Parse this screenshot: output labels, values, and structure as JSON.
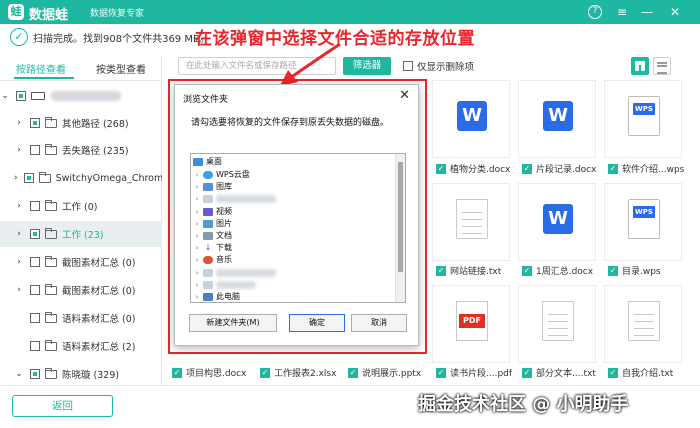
{
  "app": {
    "logo_char": "蛙",
    "name": "数据蛙",
    "subtitle": "数据恢复专家",
    "help_glyph": "?",
    "menu_glyph": "≡",
    "min_glyph": "—",
    "close_glyph": "✕"
  },
  "status": {
    "check_glyph": "✓",
    "text": "扫描完成。找到908个文件共369 MB。"
  },
  "headline": "在该弹窗中选择文件合适的存放位置",
  "left_panel": {
    "tabs": [
      "按路径查看",
      "按类型查看"
    ],
    "items": [
      {
        "label": "其他路径 (268)"
      },
      {
        "label": "丢失路径 (235)"
      },
      {
        "label": "SwitchyOmega_Chromium"
      },
      {
        "label": "工作 (0)"
      },
      {
        "label": "工作 (23)"
      },
      {
        "label": "截图素材汇总 (0)"
      },
      {
        "label": "截图素材汇总 (0)"
      },
      {
        "label": "语料素材汇总 (0)"
      },
      {
        "label": "语料素材汇总 (2)"
      },
      {
        "label": "陈晓璇 (329)"
      }
    ]
  },
  "toolbar": {
    "search_placeholder": "在此处输入文件名或保存路径",
    "filter_label": "筛选器",
    "show_deleted_label": "仅显示删除项"
  },
  "files": [
    {
      "name": "植物分类.docx",
      "type": "word"
    },
    {
      "name": "片段记录.docx",
      "type": "word"
    },
    {
      "name": "软件介绍...wps",
      "type": "wps"
    },
    {
      "name": "网站链接.txt",
      "type": "txt"
    },
    {
      "name": "1周汇总.docx",
      "type": "word"
    },
    {
      "name": "目录.wps",
      "type": "wps"
    },
    {
      "name": "读书片段....pdf",
      "type": "pdf"
    },
    {
      "name": "部分文本....txt",
      "type": "txt"
    },
    {
      "name": "自我介绍.txt",
      "type": "txt"
    }
  ],
  "bottom_files": [
    "项目构思.docx",
    "工作报表2.xlsx",
    "说明展示.pptx"
  ],
  "dialog": {
    "title": "浏览文件夹",
    "close_glyph": "✕",
    "message": "请勾选要将恢复的文件保存到原丢失数据的磁盘。",
    "tree": {
      "root": "桌面",
      "items": [
        "WPS云盘",
        "图库",
        "视频",
        "图片",
        "文档",
        "下载",
        "音乐",
        "此电脑"
      ]
    },
    "new_folder_label": "新建文件夹(M)",
    "ok_label": "确定",
    "cancel_label": "取消"
  },
  "back_label": "返回",
  "watermark": "掘金技术社区 @ 小明助手",
  "colors": {
    "accent": "#1eb8a0",
    "red": "#e8262c",
    "word": "#2a6ce5"
  }
}
